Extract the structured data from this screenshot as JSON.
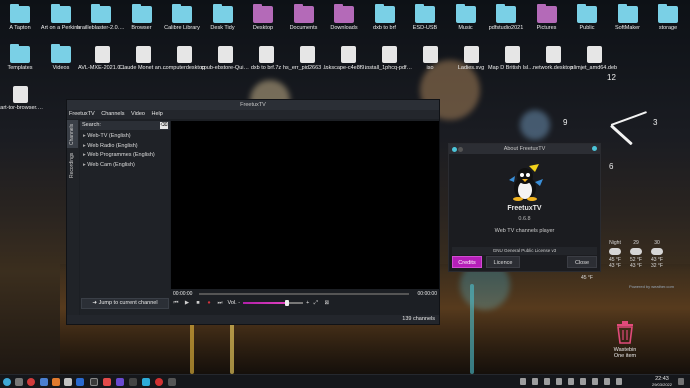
{
  "desktop": {
    "row1": [
      {
        "label": "A Tapton",
        "kind": "folder"
      },
      {
        "label": "Art on a Perkins",
        "kind": "folder"
      },
      {
        "label": "brailleblaster-2.0.22-stable",
        "kind": "folder"
      },
      {
        "label": "Browser",
        "kind": "folder"
      },
      {
        "label": "Calibre Library",
        "kind": "folder"
      },
      {
        "label": "Desk Tidy",
        "kind": "folder"
      },
      {
        "label": "Desktop",
        "kind": "folder-mag"
      },
      {
        "label": "Documents",
        "kind": "folder-mag"
      },
      {
        "label": "Downloads",
        "kind": "folder-mag"
      },
      {
        "label": "dxb to brf",
        "kind": "folder"
      },
      {
        "label": "ESD-USB",
        "kind": "folder"
      },
      {
        "label": "Music",
        "kind": "folder"
      },
      {
        "label": "pdfstudio2021",
        "kind": "folder"
      },
      {
        "label": "Pictures",
        "kind": "folder-mag"
      },
      {
        "label": "Public",
        "kind": "folder"
      },
      {
        "label": "SoftMaker",
        "kind": "folder"
      },
      {
        "label": "storage",
        "kind": "folder"
      }
    ],
    "row2": [
      {
        "label": "Templates",
        "kind": "folder"
      },
      {
        "label": "Videos",
        "kind": "folder"
      },
      {
        "label": "AVL-MXE-2021.06...",
        "kind": "file"
      },
      {
        "label": "Claude Monet and a Child in...",
        "kind": "file"
      },
      {
        "label": "computerdesktop",
        "kind": "file"
      },
      {
        "label": "cpub-ebstore-Quick-Union...",
        "kind": "file"
      },
      {
        "label": "dxb to brf.7z",
        "kind": "file"
      },
      {
        "label": "hs_err_pid2663 2.log",
        "kind": "file"
      },
      {
        "label": "Inkscape-c4e8f9e-x86_6...",
        "kind": "file"
      },
      {
        "label": "install_1phcq-pdfstudio202...",
        "kind": "file"
      },
      {
        "label": "iso",
        "kind": "file"
      },
      {
        "label": "Ladies.svg",
        "kind": "file"
      },
      {
        "label": "Map D British Isles - Greysca...",
        "kind": "file"
      },
      {
        "label": "network.desktop",
        "kind": "file"
      },
      {
        "label": "slimjet_amd64.deb",
        "kind": "file"
      }
    ],
    "row3": [
      {
        "label": "start-tor-browser.desk...",
        "kind": "file"
      }
    ]
  },
  "main_window": {
    "title": "FreetuxTV",
    "menu": [
      "FreetuxTV",
      "Channels",
      "Video",
      "Help"
    ],
    "side_tabs": [
      "Channels",
      "Recordings"
    ],
    "search_placeholder": "Search:",
    "channel_groups": [
      "Web-TV (English)",
      "Web Radio (English)",
      "Web Programmes (English)",
      "Web Cam (English)"
    ],
    "jump_button": "Jump to current channel",
    "time_start": "00:00:00",
    "time_end": "00:00:00",
    "volume_label": "Vol. -",
    "volume_plus": "+",
    "status": "139 channels"
  },
  "about_dialog": {
    "title": "About FreetuxTV",
    "app_name": "FreetuxTV",
    "version": "0.6.8",
    "description": "Web TV channels player",
    "license": "GNU General Public License v3",
    "buttons": {
      "credits": "Credits",
      "licence": "Licence",
      "close": "Close"
    }
  },
  "clock_widget": {
    "numbers": [
      "12",
      "3",
      "6",
      "9"
    ]
  },
  "weather_widget": {
    "days": [
      {
        "label": "",
        "high": "",
        "low": "45 °F"
      },
      {
        "label": "Night",
        "high": "45 °F",
        "low": "43 °F"
      },
      {
        "label": "29",
        "high": "52 °F",
        "low": "43 °F"
      },
      {
        "label": "30",
        "high": "43 °F",
        "low": "32 °F"
      }
    ],
    "credit": "Powered by weather.com"
  },
  "trash": {
    "label": "Wastebin",
    "sub": "One item"
  },
  "taskbar": {
    "time": "22:43",
    "date": "29/03/2022"
  },
  "colors": {
    "accent": "#b51fb8",
    "folder": "#7ad0e6"
  }
}
